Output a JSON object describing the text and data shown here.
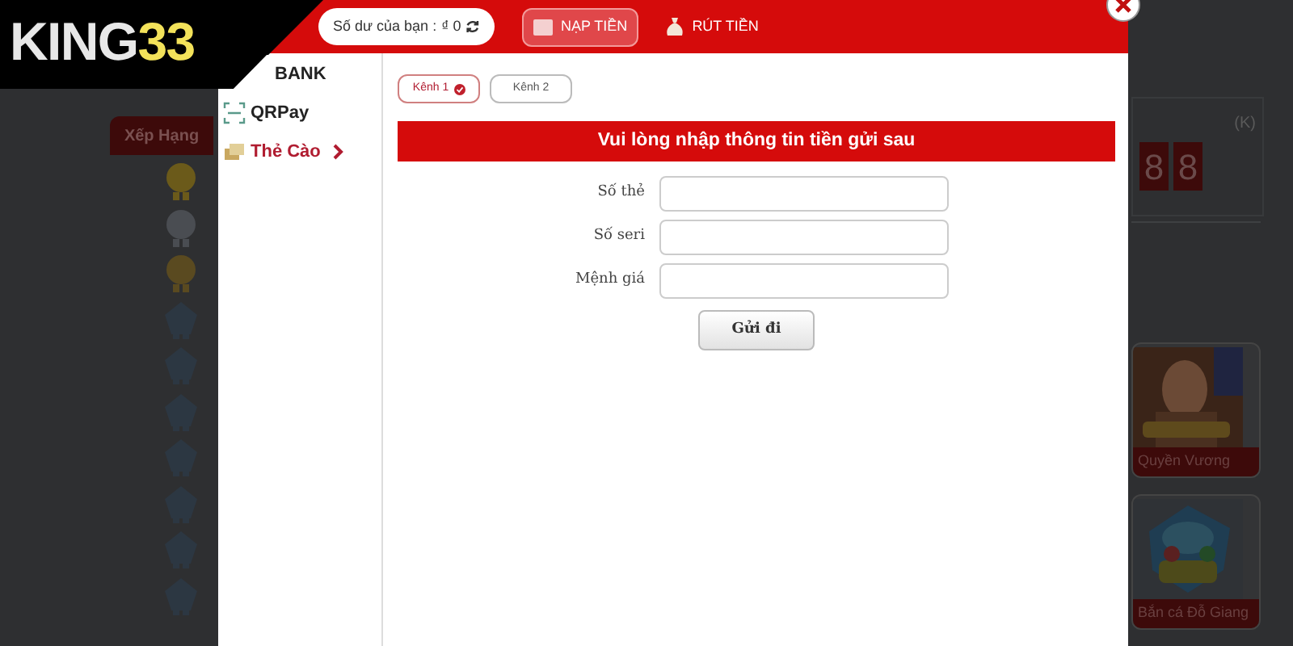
{
  "logo": {
    "word": "KING",
    "number": "33"
  },
  "background": {
    "ranking_tab": "Xếp Hạng",
    "medals": [
      {
        "kind": "gold"
      },
      {
        "kind": "silver"
      },
      {
        "kind": "bronze"
      },
      {
        "kind": "star"
      },
      {
        "kind": "star"
      },
      {
        "kind": "star"
      },
      {
        "kind": "star"
      },
      {
        "kind": "star"
      },
      {
        "kind": "star"
      },
      {
        "kind": "star"
      }
    ],
    "unit": "(K)",
    "digits": [
      "8",
      "8"
    ],
    "games": [
      {
        "title": "Quyền Vương",
        "kind": "picture"
      },
      {
        "title": "Bắn cá Đỗ Giang",
        "kind": "picture"
      }
    ]
  },
  "modal": {
    "balance_label": "Số dư của bạn :",
    "balance": "₫ 0",
    "header_tabs": [
      {
        "label": "NẠP TIỀN",
        "selected": true,
        "kind": "card"
      },
      {
        "label": "RÚT TIỀN",
        "selected": false,
        "kind": "bag"
      }
    ],
    "methods": [
      {
        "label": "BANK",
        "selected": false
      },
      {
        "label": "QRPay",
        "selected": false,
        "kind": "qr"
      },
      {
        "label": "Thẻ Cào",
        "selected": true,
        "kind": "card"
      }
    ],
    "channels": [
      {
        "label": "Kênh 1",
        "selected": true
      },
      {
        "label": "Kênh 2",
        "selected": false
      }
    ],
    "banner": "Vui lòng nhập thông tin tiền gửi sau",
    "fields": [
      {
        "label": "Số thẻ"
      },
      {
        "label": "Số seri"
      },
      {
        "label": "Mệnh giá"
      }
    ],
    "submit": "Gửi đi"
  }
}
